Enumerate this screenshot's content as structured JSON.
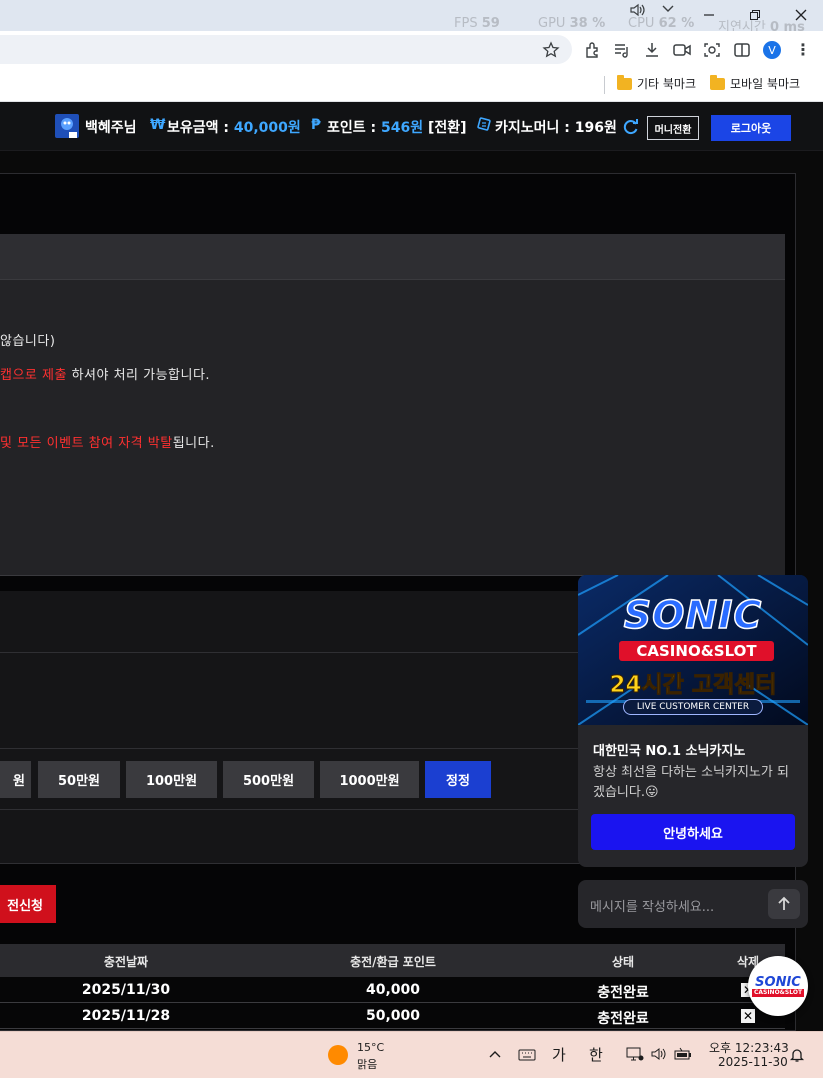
{
  "overlay": {
    "fps_label": "FPS",
    "fps_value": "59",
    "gpu_label": "GPU",
    "gpu_value": "38 %",
    "cpu_label": "CPU",
    "cpu_value": "62 %",
    "time_label": "지연시간",
    "time_value": "0 ms"
  },
  "bookmarks": [
    {
      "label": "기타 북마크"
    },
    {
      "label": "모바일 북마크"
    }
  ],
  "browser": {
    "avatar_letter": "V"
  },
  "header": {
    "username": "백혜주님",
    "balance_symbol": "₩",
    "balance_label": "보유금액 :",
    "balance_value": "40,000원",
    "point_symbol": "₱",
    "point_label": "포인트 :",
    "point_value": "546원",
    "point_convert": "[전환]",
    "casino_label": "카지노머니 :",
    "casino_value": "196원",
    "money_convert_button": "머니전환",
    "logout_button": "로그아웃"
  },
  "notice": {
    "line1": "않습니다)",
    "line2_red": "캡으로 제출",
    "line2_rest": " 하셔야 처리 가능합니다.",
    "line3_red": "및 모든 이벤트 참여 자격 박탈",
    "line3_rest": "됩니다."
  },
  "amount_buttons": [
    "원",
    "50만원",
    "100만원",
    "500만원",
    "1000만원",
    "정정"
  ],
  "apply_button": "전신청",
  "history_table": {
    "columns": [
      "충전날짜",
      "충전/환급 포인트",
      "상태",
      "삭제"
    ],
    "rows": [
      {
        "date": "2025/11/30",
        "points": "40,000",
        "status": "충전완료",
        "delete": "✕"
      },
      {
        "date": "2025/11/28",
        "points": "50,000",
        "status": "충전완료",
        "delete": "✕"
      }
    ]
  },
  "chat": {
    "banner_brand": "SONIC",
    "banner_sub": "CASINO&SLOT",
    "banner_headline": "24시간 고객센터",
    "banner_caption": "LIVE CUSTOMER CENTER",
    "title": "대한민국 NO.1 소닉카지노",
    "description": "항상 최선을 다하는 소닉카지노가 되겠습니다.😛",
    "hello_button": "안녕하세요",
    "input_placeholder": "메시지를 작성하세요...",
    "float_logo_text": "SONIC",
    "float_logo_sub": "CASINO&SLOT"
  },
  "taskbar": {
    "temperature": "15°C",
    "weather": "맑음",
    "ime_ga": "가",
    "ime_han": "한",
    "time": "오후 12:23:43",
    "date": "2025-11-30"
  },
  "colors": {
    "accent_blue": "#1b45e6",
    "value_blue": "#3ea7ff",
    "warning_red": "#ff3030",
    "apply_red": "#d0101c",
    "chat_button": "#1a14f0"
  }
}
